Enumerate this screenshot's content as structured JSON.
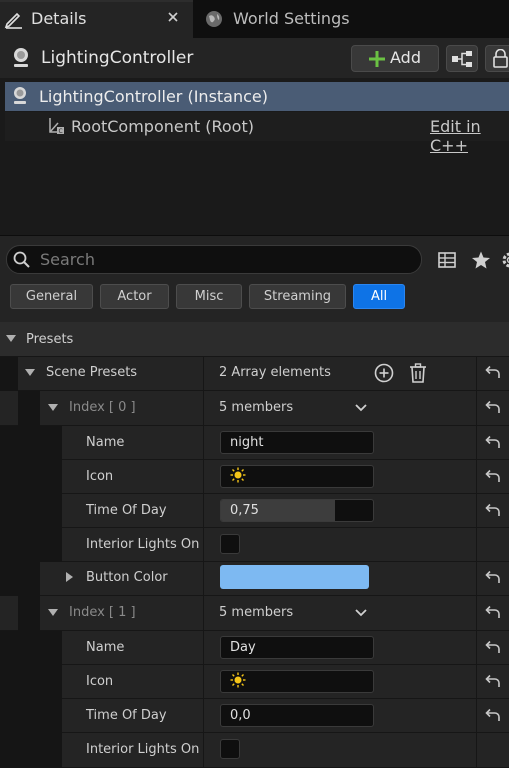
{
  "tabs": [
    {
      "label": "Details",
      "active": true
    },
    {
      "label": "World Settings",
      "active": false
    }
  ],
  "header": {
    "actor_name": "LightingController",
    "add_label": "Add"
  },
  "components": [
    {
      "label": "LightingController (Instance)",
      "selected": true
    },
    {
      "label": "RootComponent (Root)",
      "link": "Edit in C++"
    }
  ],
  "search": {
    "placeholder": "Search"
  },
  "filters": [
    "General",
    "Actor",
    "Misc",
    "Streaming",
    "All"
  ],
  "active_filter": "All",
  "category": "Presets",
  "scene_presets": {
    "label": "Scene Presets",
    "value": "2 Array elements"
  },
  "index0": {
    "label": "Index [ 0 ]",
    "value": "5 members",
    "name_label": "Name",
    "name_value": "night",
    "icon_label": "Icon",
    "time_label": "Time Of Day",
    "time_value": "0,75",
    "time_fill": 0.75,
    "interior_label": "Interior Lights On",
    "button_color_label": "Button Color",
    "button_color": "#7db9f2"
  },
  "index1": {
    "label": "Index [ 1 ]",
    "value": "5 members",
    "name_label": "Name",
    "name_value": "Day",
    "icon_label": "Icon",
    "time_label": "Time Of Day",
    "time_value": "0,0",
    "interior_label": "Interior Lights On"
  },
  "colors": {
    "accent": "#0e73e6",
    "selection": "#4a5c75",
    "add_icon": "#6bc243",
    "sun_icon": "#f5c518"
  }
}
